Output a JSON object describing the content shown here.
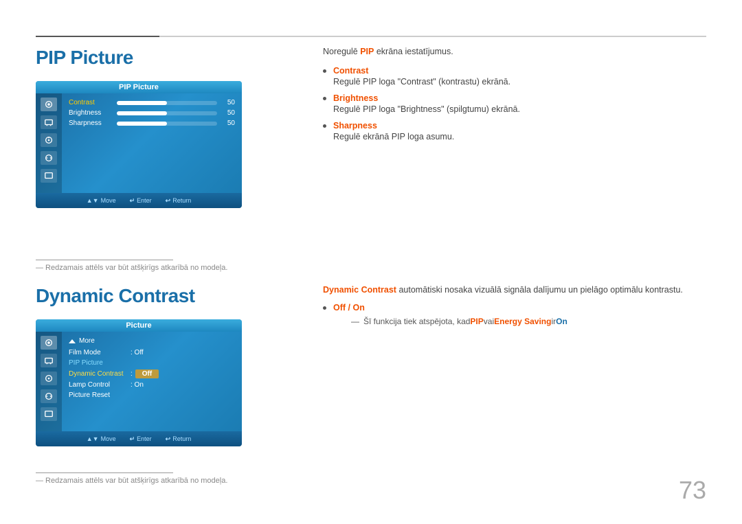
{
  "top_line": {},
  "pip_section": {
    "title": "PIP Picture",
    "tv": {
      "title_bar": "PIP Picture",
      "menu_items": [
        {
          "label": "Contrast",
          "value": 50
        },
        {
          "label": "Brightness",
          "value": 50
        },
        {
          "label": "Sharpness",
          "value": 50
        }
      ],
      "bottom_bar": [
        {
          "key": "▲▼",
          "action": "Move"
        },
        {
          "key": "↵",
          "action": "Enter"
        },
        {
          "key": "↩",
          "action": "Return"
        }
      ]
    },
    "description": {
      "intro": "Noregulē PIP ekrāna iestatījumus.",
      "intro_bold": "PIP",
      "bullets": [
        {
          "term": "Contrast",
          "text": "Regulē PIP loga \"Contrast\" (kontrastu) ekrānā."
        },
        {
          "term": "Brightness",
          "text": "Regulē PIP loga \"Brightness\" (spilgtumu) ekrānā."
        },
        {
          "term": "Sharpness",
          "text": "Regulē ekrānā PIP loga asumu."
        }
      ]
    },
    "footnote": "― Redzamais attēls var būt atšķirīgs atkarībā no modeļa."
  },
  "dc_section": {
    "title": "Dynamic Contrast",
    "tv": {
      "title_bar": "Picture",
      "menu": {
        "more_label": "More",
        "items": [
          {
            "label": "Film Mode",
            "value": ": Off",
            "style": "normal"
          },
          {
            "label": "PIP Picture",
            "value": "",
            "style": "pip"
          },
          {
            "label": "Dynamic Contrast",
            "value": ": Off",
            "value_on": "Off",
            "style": "active"
          },
          {
            "label": "Lamp Control",
            "value": ": On",
            "style": "normal"
          },
          {
            "label": "Picture Reset",
            "value": "",
            "style": "normal"
          }
        ]
      },
      "bottom_bar": [
        {
          "key": "▲▼",
          "action": "Move"
        },
        {
          "key": "↵",
          "action": "Enter"
        },
        {
          "key": "↩",
          "action": "Return"
        }
      ]
    },
    "description": {
      "intro_bold": "Dynamic Contrast",
      "intro_text": " automātiski nosaka vizuālā signāla dalījumu un pielāgo optimālu kontrastu.",
      "bullet_label": "Off / On",
      "sub_note_prefix": "Šī funkcija tiek atspējota, kad ",
      "sub_note_bold1": "PIP",
      "sub_note_mid": " vai ",
      "sub_note_bold2": "Energy Saving",
      "sub_note_suffix": " ir ",
      "sub_note_end": "On"
    },
    "footnote": "― Redzamais attēls var būt atšķirīgs atkarībā no modeļa."
  },
  "page_number": "73"
}
